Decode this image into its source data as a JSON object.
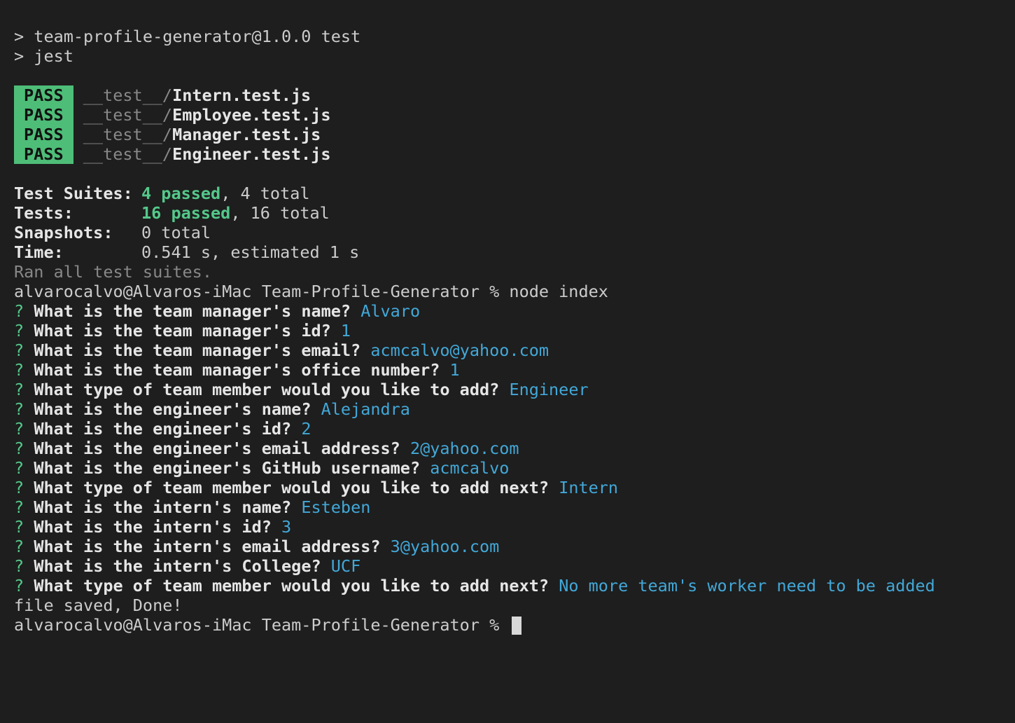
{
  "script_header": {
    "line1": "> team-profile-generator@1.0.0 test",
    "line2": "> jest"
  },
  "test_results": [
    {
      "status": "PASS",
      "dir": "__test__/",
      "file": "Intern.test.js"
    },
    {
      "status": "PASS",
      "dir": "__test__/",
      "file": "Employee.test.js"
    },
    {
      "status": "PASS",
      "dir": "__test__/",
      "file": "Manager.test.js"
    },
    {
      "status": "PASS",
      "dir": "__test__/",
      "file": "Engineer.test.js"
    }
  ],
  "summary": {
    "suites_label": "Test Suites:",
    "suites_passed": "4 passed",
    "suites_total": ", 4 total",
    "tests_label": "Tests:",
    "tests_passed": "16 passed",
    "tests_total": ", 16 total",
    "snapshots_label": "Snapshots:",
    "snapshots_value": "0 total",
    "time_label": "Time:",
    "time_value": "0.541 s, estimated 1 s",
    "ran_all": "Ran all test suites."
  },
  "prompt": {
    "text": "alvarocalvo@Alvaros-iMac Team-Profile-Generator % ",
    "command": "node index"
  },
  "qa": [
    {
      "mark": "?",
      "question": "What is the team manager's name?",
      "answer": "Alvaro"
    },
    {
      "mark": "?",
      "question": "What is the team manager's id?",
      "answer": "1"
    },
    {
      "mark": "?",
      "question": "What is the team manager's email?",
      "answer": "acmcalvo@yahoo.com"
    },
    {
      "mark": "?",
      "question": "What is the team manager's office number?",
      "answer": "1"
    },
    {
      "mark": "?",
      "question": "What type of team member would you like to add?",
      "answer": "Engineer"
    },
    {
      "mark": "?",
      "question": "What is the engineer's name?",
      "answer": "Alejandra"
    },
    {
      "mark": "?",
      "question": "What is the engineer's id?",
      "answer": "2"
    },
    {
      "mark": "?",
      "question": "What is the engineer's email address?",
      "answer": "2@yahoo.com"
    },
    {
      "mark": "?",
      "question": "What is the engineer's GitHub username?",
      "answer": "acmcalvo"
    },
    {
      "mark": "?",
      "question": "What type of team member would you like to add next?",
      "answer": "Intern"
    },
    {
      "mark": "?",
      "question": "What is the intern's name?",
      "answer": "Esteben"
    },
    {
      "mark": "?",
      "question": "What is the intern's id?",
      "answer": "3"
    },
    {
      "mark": "?",
      "question": "What is the intern's email address?",
      "answer": "3@yahoo.com"
    },
    {
      "mark": "?",
      "question": "What is the intern's College?",
      "answer": "UCF"
    },
    {
      "mark": "?",
      "question": "What type of team member would you like to add next?",
      "answer": "No more team's worker need to be added"
    }
  ],
  "done_message": "file saved, Done!",
  "final_prompt": "alvarocalvo@Alvaros-iMac Team-Profile-Generator % "
}
